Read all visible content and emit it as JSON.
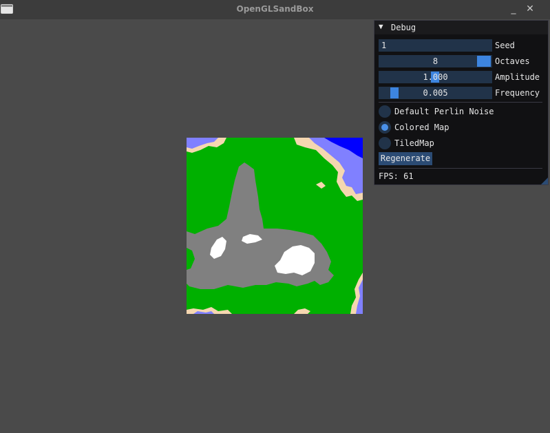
{
  "window": {
    "title": "OpenGLSandBox",
    "minimize_glyph": "_",
    "close_glyph": "✕"
  },
  "debug": {
    "title": "Debug",
    "collapse_glyph": "▼",
    "seed": {
      "label": "Seed",
      "value": "1"
    },
    "octaves": {
      "label": "Octaves",
      "value": "8"
    },
    "amplitude": {
      "label": "Amplitude",
      "value": "1.000"
    },
    "frequency": {
      "label": "Frequency",
      "value": "0.005"
    },
    "modes": [
      {
        "label": "Default Perlin Noise",
        "selected": false
      },
      {
        "label": "Colored Map",
        "selected": true
      },
      {
        "label": "TiledMap",
        "selected": false
      }
    ],
    "regenerate_label": "Regenerate",
    "fps_text": "FPS: 61"
  },
  "colors": {
    "background": "#4a4a4a",
    "titlebar": "#3c3c3c",
    "panel_bg": "#111113",
    "widget_bg": "#213349",
    "accent": "#3d85e0",
    "grass": "#00b000",
    "rock": "#808080",
    "snow": "#ffffff",
    "sand": "#f5d7b0",
    "shallow_water": "#8080ff",
    "deep_water": "#0000ff"
  }
}
